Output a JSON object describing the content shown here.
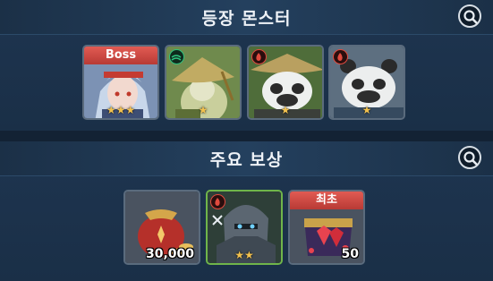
{
  "monsters_section": {
    "title": "등장 몬스터",
    "search_icon": "magnifier-icon",
    "cards": [
      {
        "banner": "Boss",
        "element_icon": null,
        "stars": 3,
        "portrait": "white-haired-boss-portrait"
      },
      {
        "banner": null,
        "element_icon": "wind-element-icon",
        "stars": 1,
        "portrait": "straw-hat-archer-portrait"
      },
      {
        "banner": null,
        "element_icon": "fire-element-icon",
        "stars": 1,
        "portrait": "panda-warrior-portrait"
      },
      {
        "banner": null,
        "element_icon": "fire-element-icon",
        "stars": 1,
        "portrait": "panda-brawler-portrait"
      }
    ]
  },
  "rewards_section": {
    "title": "주요 보상",
    "search_icon": "magnifier-icon",
    "cards": [
      {
        "banner": null,
        "stars": 0,
        "quantity": "30,000",
        "portrait": "gold-pouch"
      },
      {
        "banner": null,
        "stars": 2,
        "quantity": "",
        "element_icon": "fire-element-icon",
        "class_icon": "crossed-swords-icon",
        "portrait": "armored-knight-portrait"
      },
      {
        "banner": "최초",
        "stars": 0,
        "quantity": "50",
        "portrait": "red-gem-chest"
      }
    ]
  },
  "colors": {
    "banner_red": "#c9463f",
    "star_gold": "#f2c14e",
    "fire_red": "#e04a3e",
    "wind_green": "#2ec27e"
  }
}
